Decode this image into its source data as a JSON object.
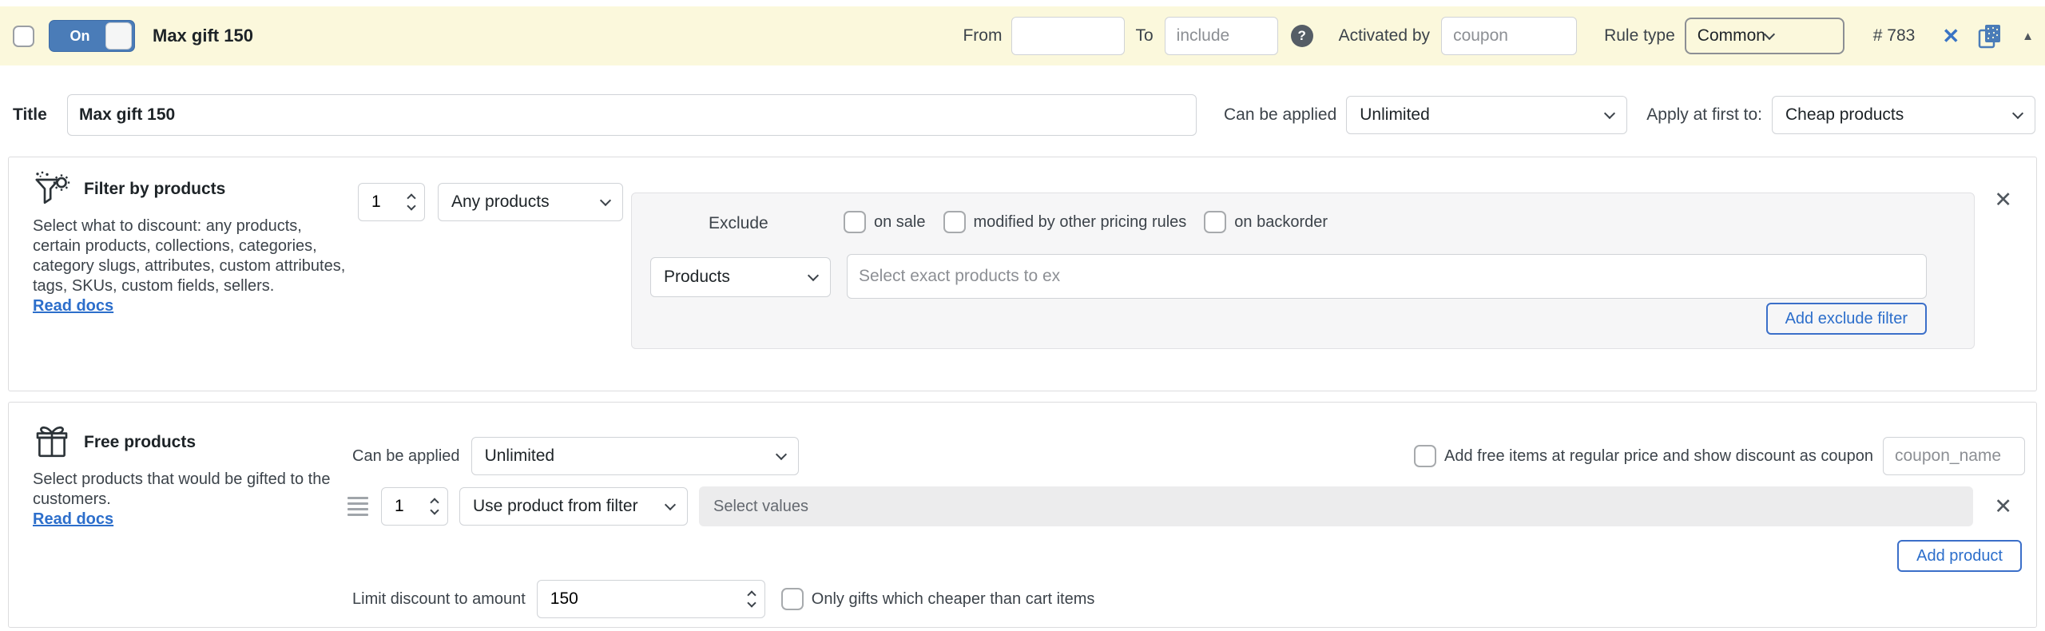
{
  "colors": {
    "bar_bg": "#fbf8dc",
    "accent_blue": "#4a7cb8",
    "link_blue": "#2c6ecb",
    "panel_bg": "#f6f6f7",
    "border": "#dcdcde"
  },
  "header": {
    "toggle_label": "On",
    "title": "Max gift 150",
    "from_label": "From",
    "to_label": "To",
    "to_placeholder": "include",
    "help_icon": "?",
    "activated_by_label": "Activated by",
    "activated_by_placeholder": "coupon",
    "rule_type_label": "Rule type",
    "rule_type_value": "Common",
    "rule_id": "# 783",
    "delete_icon": "✕",
    "collapse_icon": "▲"
  },
  "title_row": {
    "label": "Title",
    "value": "Max gift 150",
    "can_be_applied_label": "Can be applied",
    "can_be_applied_value": "Unlimited",
    "apply_at_first_label": "Apply at first to:",
    "apply_at_first_value": "Cheap products"
  },
  "filter_section": {
    "heading": "Filter by products",
    "description": "Select what to discount: any products, certain products, collections, categories, category slugs, attributes, custom attributes, tags, SKUs, custom fields, sellers.",
    "read_docs_label": "Read docs",
    "qty_value": "1",
    "filter_type_value": "Any products",
    "close_icon": "✕",
    "exclude": {
      "label": "Exclude",
      "options": [
        {
          "label": "on sale",
          "checked": false
        },
        {
          "label": "modified by other pricing rules",
          "checked": false
        },
        {
          "label": "on backorder",
          "checked": false
        }
      ],
      "entity_value": "Products",
      "search_placeholder": "Select exact products to ex",
      "add_button_label": "Add exclude filter"
    }
  },
  "free_section": {
    "heading": "Free products",
    "description": "Select products that would be gifted to the customers.",
    "read_docs_label": "Read docs",
    "can_be_applied_label": "Can be applied",
    "can_be_applied_value": "Unlimited",
    "coupon_option_label": "Add free items at regular price and show discount as coupon",
    "coupon_placeholder": "coupon_name",
    "row": {
      "qty_value": "1",
      "source_value": "Use product from filter",
      "values_placeholder": "Select values",
      "close_icon": "✕"
    },
    "add_button_label": "Add product",
    "limit_label": "Limit discount to amount",
    "limit_value": "150",
    "cheaper_option_label": "Only gifts which cheaper than cart items"
  }
}
